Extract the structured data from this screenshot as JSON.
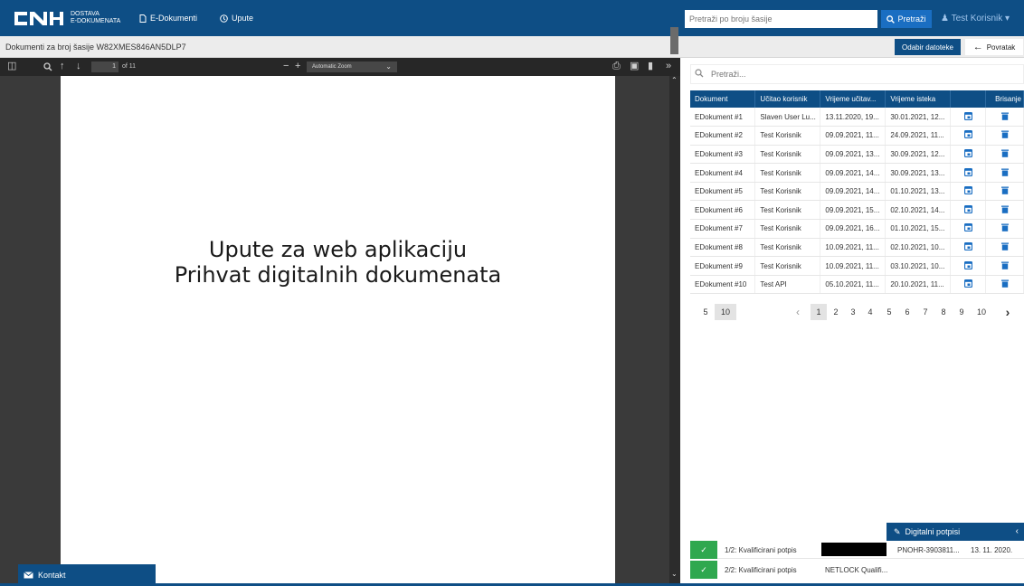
{
  "header": {
    "logo_text": "CNH",
    "brand_line1": "DOSTAVA",
    "brand_line2": "E-DOKUMENATA",
    "nav": [
      {
        "label": "E-Dokumenti",
        "icon": "document-icon"
      },
      {
        "label": "Upute",
        "icon": "help-icon"
      }
    ],
    "search_placeholder": "Pretraži po broju šasije",
    "search_button": "Pretraži",
    "user": "Test Korisnik"
  },
  "subheader": {
    "title": "Dokumenti za broj šasije W82XMES846AN5DLP7",
    "select_files": "Odabir datoteke",
    "back": "Povratak"
  },
  "viewer": {
    "page_number": "1",
    "page_count": "of 11",
    "zoom": "Automatic Zoom",
    "page_line1": "Upute za web aplikaciju",
    "page_line2": "Prihvat digitalnih dokumenata"
  },
  "documents": {
    "search_placeholder": "Pretraži...",
    "columns": [
      "Dokument",
      "Učitao korisnik",
      "Vrijeme učitav...",
      "Vrijeme isteka",
      "",
      "Brisanje"
    ],
    "rows": [
      [
        "EDokument #1",
        "Slaven User Lu...",
        "13.11.2020, 19...",
        "30.01.2021, 12..."
      ],
      [
        "EDokument #2",
        "Test Korisnik",
        "09.09.2021, 11...",
        "24.09.2021, 11..."
      ],
      [
        "EDokument #3",
        "Test Korisnik",
        "09.09.2021, 13...",
        "30.09.2021, 12..."
      ],
      [
        "EDokument #4",
        "Test Korisnik",
        "09.09.2021, 14...",
        "30.09.2021, 13..."
      ],
      [
        "EDokument #5",
        "Test Korisnik",
        "09.09.2021, 14...",
        "01.10.2021, 13..."
      ],
      [
        "EDokument #6",
        "Test Korisnik",
        "09.09.2021, 15...",
        "02.10.2021, 14..."
      ],
      [
        "EDokument #7",
        "Test Korisnik",
        "09.09.2021, 16...",
        "01.10.2021, 15..."
      ],
      [
        "EDokument #8",
        "Test Korisnik",
        "10.09.2021, 11...",
        "02.10.2021, 10..."
      ],
      [
        "EDokument #9",
        "Test Korisnik",
        "10.09.2021, 11...",
        "03.10.2021, 10..."
      ],
      [
        "EDokument #10",
        "Test API",
        "05.10.2021, 11...",
        "20.10.2021, 11..."
      ]
    ]
  },
  "pagination": {
    "page_sizes": [
      "5",
      "10"
    ],
    "selected_size": "10",
    "pages": [
      "1",
      "2",
      "3",
      "4",
      "5",
      "6",
      "7",
      "8",
      "9",
      "10"
    ],
    "current_page": "1"
  },
  "signatures": {
    "title": "Digitalni potpisi",
    "rows": [
      {
        "label": "1/2: Kvalificirani potpis",
        "signer": "",
        "cert": "PNOHR-3903811...",
        "date": "13. 11. 2020."
      },
      {
        "label": "2/2: Kvalificirani potpis",
        "signer": "NETLOCK Qualifi...",
        "cert": "",
        "date": ""
      }
    ]
  },
  "footer": {
    "contact": "Kontakt"
  },
  "colors": {
    "primary": "#0e4e85",
    "accent": "#1a6ec2",
    "success": "#2fa84f"
  }
}
